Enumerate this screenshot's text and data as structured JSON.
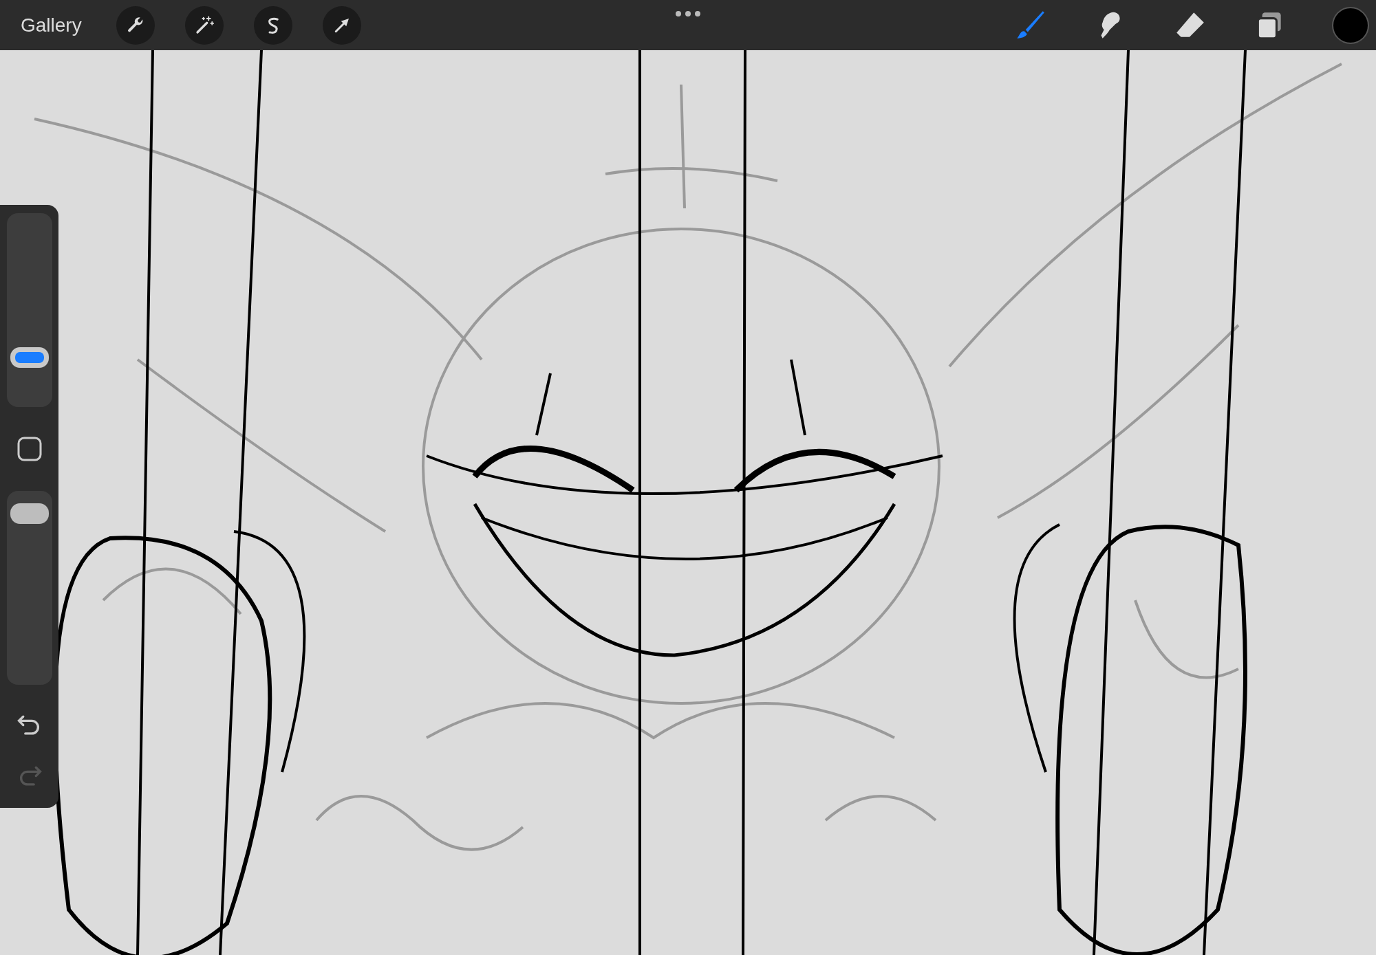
{
  "top_bar": {
    "gallery": "Gallery",
    "left_tools": [
      {
        "kind": "wrench"
      },
      {
        "kind": "wand"
      },
      {
        "kind": "selection"
      },
      {
        "kind": "arrow"
      }
    ],
    "right_tools": [
      {
        "kind": "brush",
        "selected": true
      },
      {
        "kind": "smudge",
        "selected": false
      },
      {
        "kind": "eraser",
        "selected": false
      },
      {
        "kind": "layers",
        "selected": false
      }
    ],
    "color_swatch": {
      "color": "#000000"
    }
  },
  "sidebar": {
    "sliders": [
      {
        "level": 0.22,
        "active": true
      },
      {
        "level": 0.93,
        "active": false
      }
    ],
    "undo": {
      "disabled": false
    },
    "redo": {
      "disabled": true
    }
  }
}
